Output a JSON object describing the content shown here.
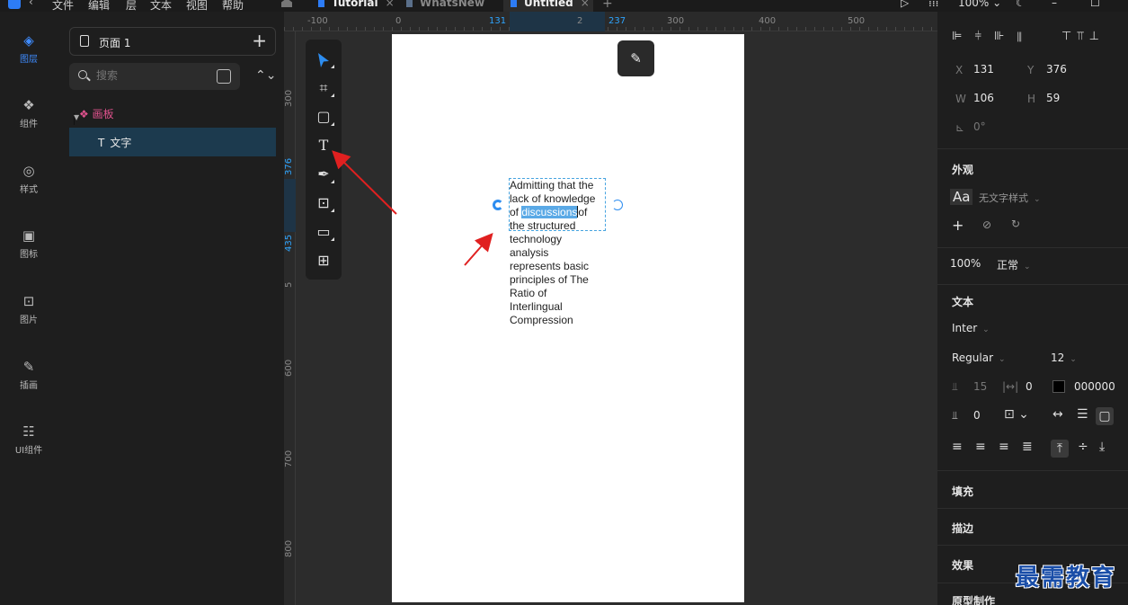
{
  "menu": {
    "items": [
      "文件",
      "编辑",
      "层",
      "文本",
      "视图",
      "帮助"
    ]
  },
  "tabs": [
    {
      "label": "Tutorial",
      "close": "×"
    },
    {
      "label": "WhatsNew",
      "close": ""
    },
    {
      "label": "Untitled",
      "close": "×"
    }
  ],
  "new_tab": "+",
  "top_right": {
    "zoom": "100%",
    "zoom_chevron": "⌄",
    "minimize": "–",
    "maximize": "☐"
  },
  "rail": [
    {
      "label": "图层",
      "icon": "layers-icon",
      "glyph": "◈"
    },
    {
      "label": "组件",
      "icon": "component-icon",
      "glyph": "❖"
    },
    {
      "label": "样式",
      "icon": "style-icon",
      "glyph": "◎"
    },
    {
      "label": "图标",
      "icon": "icon-library-icon",
      "glyph": "▣"
    },
    {
      "label": "图片",
      "icon": "image-icon",
      "glyph": "⊡"
    },
    {
      "label": "插画",
      "icon": "illustration-icon",
      "glyph": "✎"
    },
    {
      "label": "UI组件",
      "icon": "ui-component-icon",
      "glyph": "☷"
    }
  ],
  "layers": {
    "page_label": "页面 1",
    "search_placeholder": "搜索",
    "board_label": "画板",
    "text_layer_prefix": "T",
    "text_layer_label": "文字"
  },
  "ruler": {
    "top": [
      "-100",
      "0",
      "131",
      "2",
      "237",
      "300",
      "400",
      "500"
    ],
    "left": [
      "300",
      "376",
      "435",
      "5",
      "600",
      "700",
      "800"
    ]
  },
  "tools": [
    "select-tool",
    "artboard-tool",
    "rectangle-tool",
    "text-tool",
    "pen-tool",
    "image-tool",
    "component-tool",
    "grid-tool"
  ],
  "canvas_text": {
    "lines": [
      {
        "before": "Admitting that the",
        "selected": "",
        "after": ""
      },
      {
        "before": "lack of knowledge",
        "selected": "",
        "after": ""
      },
      {
        "before": "of ",
        "selected": "discussions",
        "after": "of"
      },
      {
        "before": "the structured",
        "selected": "",
        "after": ""
      },
      {
        "before": "technology",
        "selected": "",
        "after": ""
      },
      {
        "before": "analysis",
        "selected": "",
        "after": ""
      },
      {
        "before": "represents basic",
        "selected": "",
        "after": ""
      },
      {
        "before": "principles of The",
        "selected": "",
        "after": ""
      },
      {
        "before": "Ratio of",
        "selected": "",
        "after": ""
      },
      {
        "before": "Interlingual",
        "selected": "",
        "after": ""
      },
      {
        "before": "Compression",
        "selected": "",
        "after": ""
      }
    ]
  },
  "props": {
    "x_label": "X",
    "x": "131",
    "y_label": "Y",
    "y": "376",
    "w_label": "W",
    "w": "106",
    "h_label": "H",
    "h": "59",
    "rotation": "0°",
    "appearance_title": "外观",
    "text_style_label": "无文字样式",
    "opacity": "100%",
    "blend": "正常",
    "text_title": "文本",
    "font_family": "Inter",
    "font_weight": "Regular",
    "font_size": "12",
    "line_height": "15",
    "letter_spacing": "0",
    "color_hex": "000000",
    "paragraph_spacing": "0",
    "fill_title": "填充",
    "stroke_title": "描边",
    "effect_title": "效果",
    "prototype_title": "原型制作",
    "text_color": "#000000"
  },
  "watermark": "最需教育",
  "colors": {
    "accent": "#2d7cf6",
    "selection": "#5aa9e6",
    "board_pink": "#e0528d",
    "annotation_red": "#e02020"
  }
}
